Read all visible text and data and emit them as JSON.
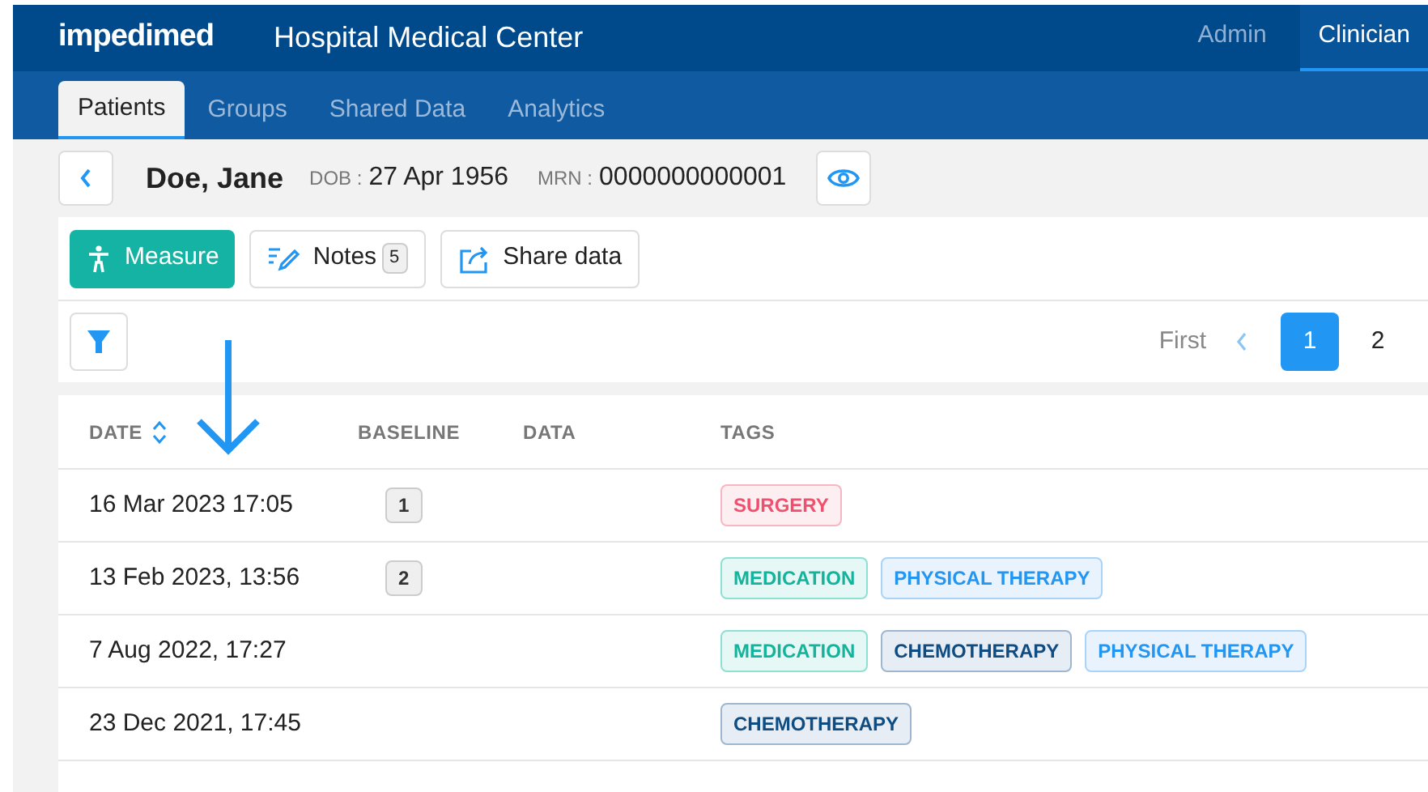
{
  "header": {
    "logo": "impedimed",
    "title": "Hospital Medical Center",
    "roles": [
      {
        "label": "Admin",
        "selected": false
      },
      {
        "label": "Clinician",
        "selected": true
      }
    ]
  },
  "tabs": [
    {
      "label": "Patients",
      "selected": true
    },
    {
      "label": "Groups",
      "selected": false
    },
    {
      "label": "Shared Data",
      "selected": false
    },
    {
      "label": "Analytics",
      "selected": false
    }
  ],
  "patient": {
    "name": "Doe, Jane",
    "dob_label": "DOB :",
    "dob": "27 Apr 1956",
    "mrn_label": "MRN :",
    "mrn": "0000000000001"
  },
  "actions": [
    {
      "kind": "measure",
      "label": "Measure"
    },
    {
      "kind": "notes",
      "label": "Notes",
      "count": "5"
    },
    {
      "kind": "share",
      "label": "Share data"
    }
  ],
  "pagination": {
    "first": "First",
    "pages": [
      {
        "label": "1",
        "selected": true
      },
      {
        "label": "2",
        "selected": false
      }
    ]
  },
  "table": {
    "columns": [
      "DATE",
      "BASELINE",
      "DATA",
      "TAGS"
    ],
    "rows": [
      {
        "date": "16 Mar 2023 17:05",
        "baseline": "1",
        "tags": [
          {
            "label": "SURGERY",
            "kind": "danger"
          }
        ]
      },
      {
        "date": "13 Feb 2023, 13:56",
        "baseline": "2",
        "tags": [
          {
            "label": "MEDICATION",
            "kind": "success"
          },
          {
            "label": "PHYSICAL THERAPY",
            "kind": "info"
          }
        ]
      },
      {
        "date": "7 Aug 2022, 17:27",
        "tags": [
          {
            "label": "MEDICATION",
            "kind": "success"
          },
          {
            "label": "CHEMOTHERAPY",
            "kind": "primary"
          },
          {
            "label": "PHYSICAL THERAPY",
            "kind": "info"
          }
        ]
      },
      {
        "date": "23 Dec 2021, 17:45",
        "tags": [
          {
            "label": "CHEMOTHERAPY",
            "kind": "primary"
          }
        ]
      }
    ]
  }
}
